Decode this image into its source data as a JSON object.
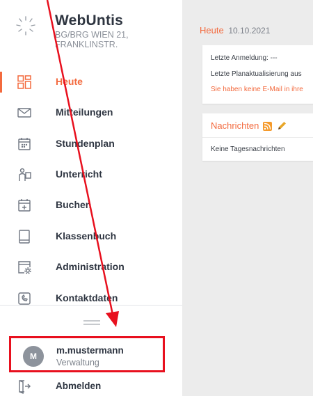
{
  "app": {
    "title": "WebUntis",
    "school": "BG/BRG WIEN 21,\nFRANKLINSTR."
  },
  "nav": {
    "items": [
      {
        "label": "Heute",
        "icon": "dashboard-icon",
        "active": true
      },
      {
        "label": "Mitteilungen",
        "icon": "envelope-icon"
      },
      {
        "label": "Stundenplan",
        "icon": "calendar-icon"
      },
      {
        "label": "Unterricht",
        "icon": "teacher-icon"
      },
      {
        "label": "Buchen",
        "icon": "calendar-plus-icon"
      },
      {
        "label": "Klassenbuch",
        "icon": "book-icon"
      },
      {
        "label": "Administration",
        "icon": "settings-window-icon"
      },
      {
        "label": "Kontaktdaten",
        "icon": "contact-card-icon"
      }
    ]
  },
  "user": {
    "initial": "M",
    "name": "m.mustermann",
    "role": "Verwaltung"
  },
  "logout": {
    "label": "Abmelden",
    "icon": "logout-door-icon"
  },
  "main": {
    "today_label": "Heute",
    "date": "10.10.2021",
    "info": {
      "last_login": "Letzte Anmeldung: ---",
      "last_update": "Letzte Planaktualisierung aus",
      "email_warning": "Sie haben keine E-Mail in ihre"
    },
    "news": {
      "title": "Nachrichten",
      "empty": "Keine Tagesnachrichten"
    }
  },
  "colors": {
    "accent": "#f36a3e",
    "highlight": "#e8101e"
  }
}
